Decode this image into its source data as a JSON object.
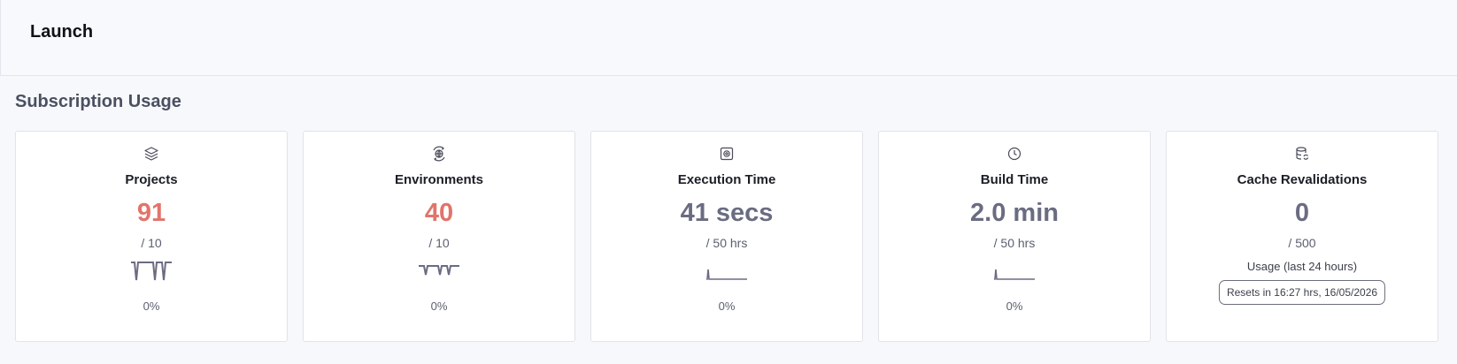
{
  "header": {
    "title": "Launch"
  },
  "section": {
    "title": "Subscription Usage"
  },
  "cards": [
    {
      "label": "Projects",
      "value": "91",
      "limit": "/ 10",
      "percent": "0%",
      "icon": "layers-icon",
      "over_limit": true
    },
    {
      "label": "Environments",
      "value": "40",
      "limit": "/ 10",
      "percent": "0%",
      "icon": "globe-sync-icon",
      "over_limit": true
    },
    {
      "label": "Execution Time",
      "value": "41 secs",
      "limit": "/ 50 hrs",
      "percent": "0%",
      "icon": "cpu-icon",
      "over_limit": false
    },
    {
      "label": "Build Time",
      "value": "2.0 min",
      "limit": "/ 50 hrs",
      "percent": "0%",
      "icon": "clock-icon",
      "over_limit": false
    },
    {
      "label": "Cache Revalidations",
      "value": "0",
      "limit": "/ 500",
      "usage_note": "Usage (last 24 hours)",
      "reset_text": "Resets in 16:27 hrs, 16/05/2026",
      "icon": "database-refresh-icon",
      "over_limit": false
    }
  ],
  "colors": {
    "over_limit_value": "#e2746b",
    "normal_value": "#6a6c82",
    "sparkline": "#6a6c82"
  }
}
